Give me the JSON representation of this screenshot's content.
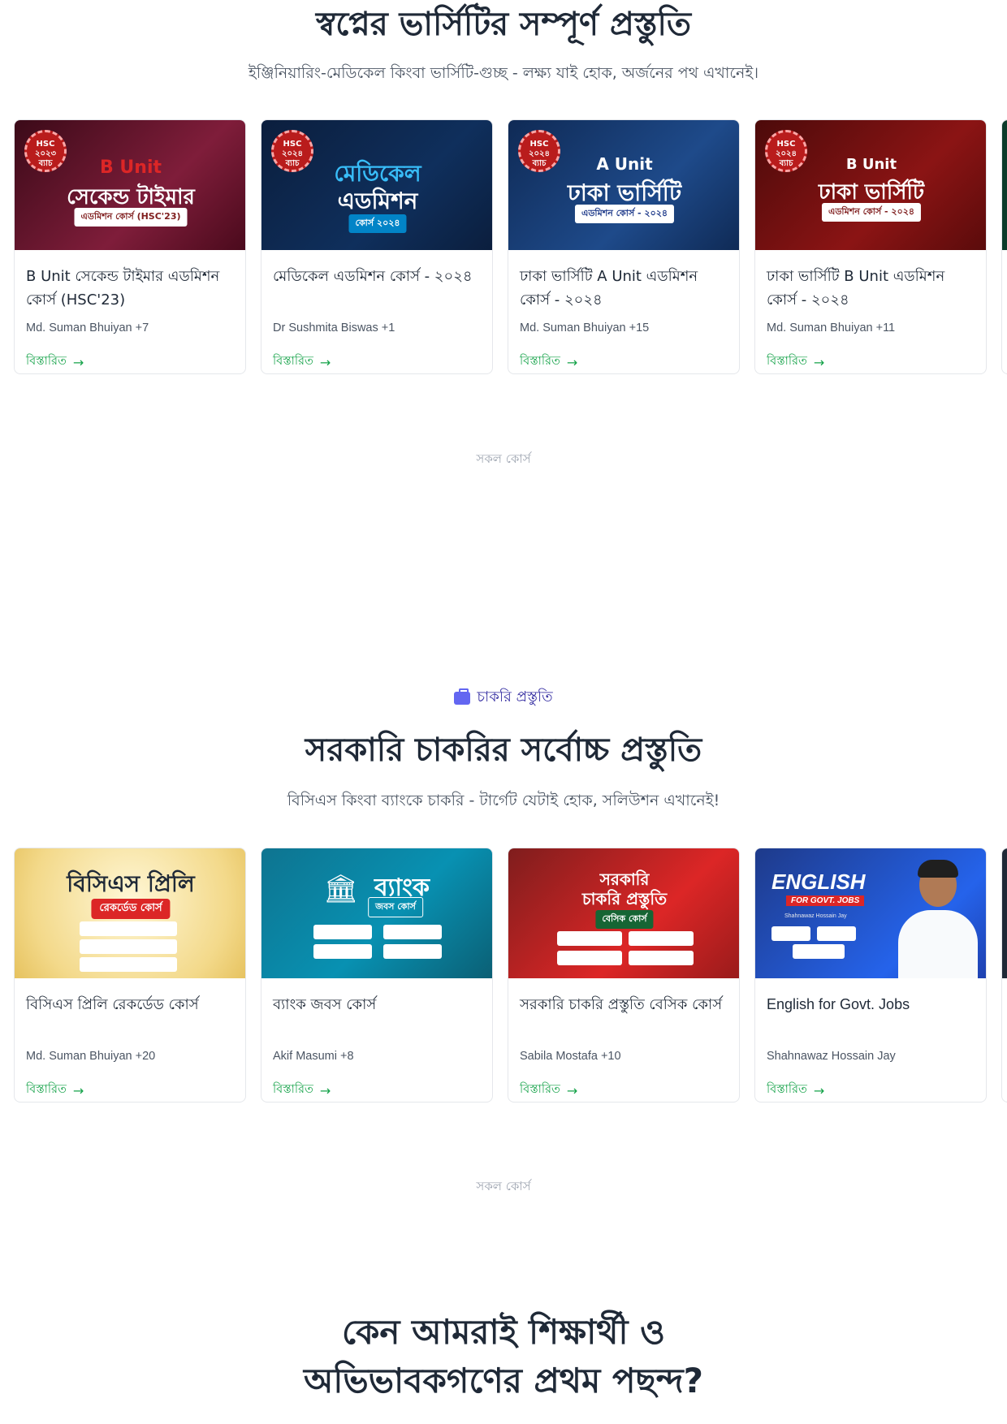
{
  "section1": {
    "title": "স্বপ্নের ভার্সিটির সম্পূর্ণ প্রস্তুতি",
    "subtitle": "ইঞ্জিনিয়ারিং-মেডিকেল কিংবা ভার্সিটি-গুচ্ছ - লক্ষ্য যাই হোক, অর্জনের পথ এখানেই।",
    "cards": [
      {
        "banner_badge": "HSC ২০২৩ ব্যাচ",
        "banner_line1": "B Unit",
        "banner_line2": "সেকেন্ড টাইমার",
        "banner_line3": "এডমিশন কোর্স (HSC'23)",
        "title": "B Unit সেকেন্ড টাইমার এডমিশন কোর্স (HSC'23)",
        "author": "Md. Suman Bhuiyan +7",
        "link": "বিস্তারিত"
      },
      {
        "banner_badge": "HSC ২০২৪ ব্যাচ",
        "banner_line1": "মেডিকেল",
        "banner_line2": "এডমিশন",
        "banner_line3": "কোর্স ২০২৪",
        "title": "মেডিকেল এডমিশন কোর্স - ২০২৪",
        "author": "Dr Sushmita Biswas +1",
        "link": "বিস্তারিত"
      },
      {
        "banner_badge": "HSC ২০২৪ ব্যাচ",
        "banner_line1": "A Unit",
        "banner_line2": "ঢাকা ভার্সিটি",
        "banner_line3": "এডমিশন কোর্স - ২০২৪",
        "title": "ঢাকা ভার্সিটি A Unit এডমিশন কোর্স - ২০২৪",
        "author": "Md. Suman Bhuiyan +15",
        "link": "বিস্তারিত"
      },
      {
        "banner_badge": "HSC ২০২৪ ব্যাচ",
        "banner_line1": "B Unit",
        "banner_line2": "ঢাকা ভার্সিটি",
        "banner_line3": "এডমিশন কোর্স - ২০২৪",
        "title": "ঢাকা ভার্সিটি B Unit এডমিশন কোর্স - ২০২৪",
        "author": "Md. Suman Bhuiyan +11",
        "link": "বিস্তারিত"
      }
    ],
    "all_courses": "সকল কোর্স"
  },
  "section2": {
    "chip": "চাকরি প্রস্তুতি",
    "title": "সরকারি চাকরির সর্বোচ্চ প্রস্তুতি",
    "subtitle": "বিসিএস কিংবা ব্যাংকে চাকরি - টার্গেট যেটাই হোক, সলিউশন এখানেই!",
    "cards": [
      {
        "banner_line1": "বিসিএস প্রিলি",
        "banner_line2": "রেকর্ডেড কোর্স",
        "title": "বিসিএস প্রিলি রেকর্ডেড কোর্স",
        "author": "Md. Suman Bhuiyan +20",
        "link": "বিস্তারিত"
      },
      {
        "banner_line1": "ব্যাংক",
        "banner_line2": "জবস কোর্স",
        "title": "ব্যাংক জবস কোর্স",
        "author": "Akif Masumi +8",
        "link": "বিস্তারিত"
      },
      {
        "banner_line1": "সরকারি",
        "banner_line2": "চাকরি প্রস্তুতি",
        "banner_line3": "বেসিক কোর্স",
        "title": "সরকারি চাকরি প্রস্তুতি বেসিক কোর্স",
        "author": "Sabila Mostafa +10",
        "link": "বিস্তারিত"
      },
      {
        "banner_line1": "ENGLISH",
        "banner_line2": "FOR GOVT. JOBS",
        "banner_line3": "Shahnawaz Hossain Jay",
        "title": "English for Govt. Jobs",
        "author": "Shahnawaz Hossain Jay",
        "link": "বিস্তারিত"
      }
    ],
    "all_courses": "সকল কোর্স"
  },
  "section3": {
    "title_line1": "কেন আমরাই শিক্ষার্থী ও",
    "title_line2": "অভিভাবকগণের প্রথম পছন্দ?"
  },
  "colors": {
    "link": "#16a34a",
    "heading": "#1f2937",
    "chip": "#3730a3"
  },
  "icons": {
    "link_arrow": "arrow-right-icon",
    "chip": "briefcase-icon"
  }
}
